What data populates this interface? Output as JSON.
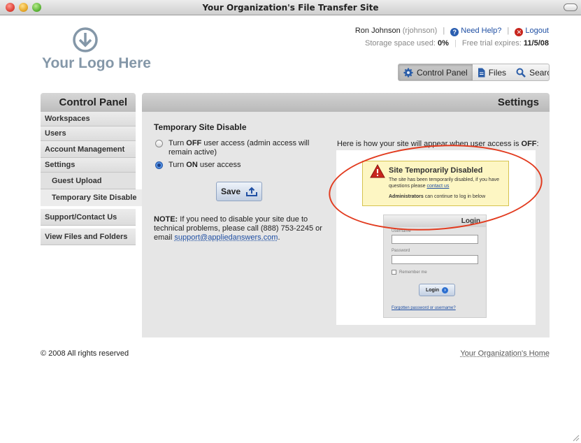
{
  "window": {
    "title": "Your Organization's File Transfer Site"
  },
  "header": {
    "logo_text": "Your Logo Here",
    "user": {
      "name": "Ron Johnson",
      "username": "(rjohnson)",
      "help_label": "Need Help?",
      "logout_label": "Logout"
    },
    "storage": {
      "label": "Storage space used:",
      "value": "0%",
      "trial_label": "Free trial expires:",
      "trial_value": "11/5/08"
    },
    "nav": [
      {
        "label": "Control Panel",
        "icon": "gear-icon",
        "active": true
      },
      {
        "label": "Files",
        "icon": "file-icon",
        "active": false
      },
      {
        "label": "Search",
        "icon": "magnifier-icon",
        "active": false
      }
    ]
  },
  "sidebar": {
    "title": "Control Panel",
    "items": [
      {
        "label": "Workspaces"
      },
      {
        "label": "Users"
      },
      {
        "label": "Account Management"
      },
      {
        "label": "Settings"
      },
      {
        "label": "Guest Upload"
      },
      {
        "label": "Temporary Site Disable"
      },
      {
        "label": "Support/Contact Us"
      },
      {
        "label": "View Files and Folders"
      }
    ]
  },
  "main": {
    "title": "Settings",
    "section_title": "Temporary Site Disable",
    "options": [
      {
        "label_pre": "Turn ",
        "label_bold": "OFF",
        "label_post": " user access (admin access will remain active)",
        "checked": false
      },
      {
        "label_pre": "Turn ",
        "label_bold": "ON",
        "label_post": " user access",
        "checked": true
      }
    ],
    "save_label": "Save",
    "note_label": "NOTE:",
    "note_text": " If you need to disable your site due to technical problems, please call (888) 753-2245 or email ",
    "note_email": "support@appliedanswers.com",
    "note_end": ".",
    "preview_label_pre": "Here is how your site will appear when user access is ",
    "preview_label_bold": "OFF",
    "preview_label_post": ":"
  },
  "preview": {
    "warning_title": "Site Temporarily Disabled",
    "warning_body": "The site has been temporarily disabled, if you have questions please ",
    "warning_link": "contact us",
    "warning_admin_bold": "Administrators",
    "warning_admin_text": " can continue to log in below",
    "login_title": "Login",
    "username_label": "Username",
    "password_label": "Password",
    "remember_label": "Remember me",
    "login_button": "Login",
    "forgot_link": "Forgotten password or username?"
  },
  "footer": {
    "copyright": "© 2008 All rights reserved",
    "home_link": "Your Organization's Home"
  },
  "colors": {
    "accent_blue": "#1f4fa3",
    "highlight_red": "#e23b1f",
    "warning_bg": "#fdf6c3"
  }
}
